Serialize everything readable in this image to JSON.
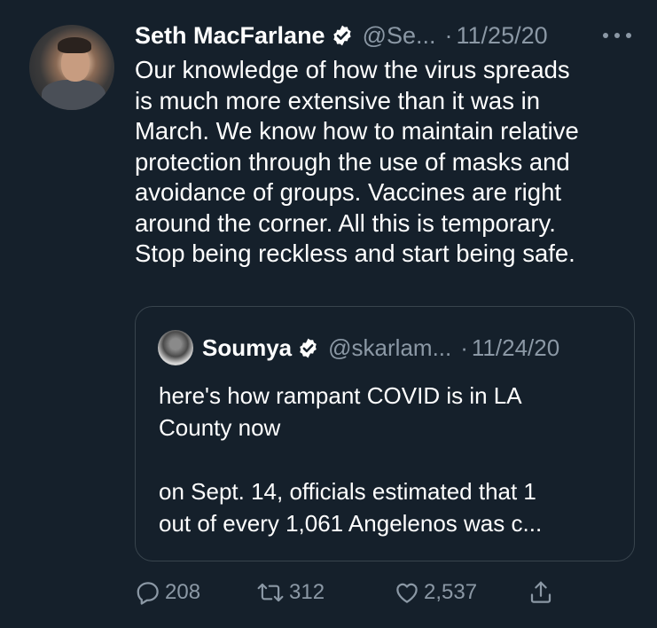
{
  "tweet": {
    "author_name": "Seth MacFarlane",
    "author_handle": "@Se...",
    "separator": "·",
    "date": "11/25/20",
    "text": "Our knowledge of how the virus spreads\nis much more extensive than it was in\nMarch. We know how to maintain relative\nprotection through the use of masks and\navoidance of groups. Vaccines are right\naround the corner. All this is temporary.\nStop being reckless and start being safe."
  },
  "quoted_tweet": {
    "author_name": "Soumya",
    "author_handle": "@skarlam...",
    "separator": "·",
    "date": "11/24/20",
    "text": "here's how rampant COVID is in LA\nCounty now\n\non Sept. 14, officials estimated that 1\nout of every 1,061 Angelenos was c..."
  },
  "actions": {
    "reply_count": "208",
    "retweet_count": "312",
    "like_count": "2,537"
  },
  "icons": {
    "verified": "verified-badge-icon",
    "more": "more-options-icon",
    "reply": "reply-icon",
    "retweet": "retweet-icon",
    "like": "heart-icon",
    "share": "share-icon"
  },
  "colors": {
    "background": "#15202b",
    "text_primary": "#ffffff",
    "text_secondary": "#8b98a5",
    "border": "#38444d"
  }
}
